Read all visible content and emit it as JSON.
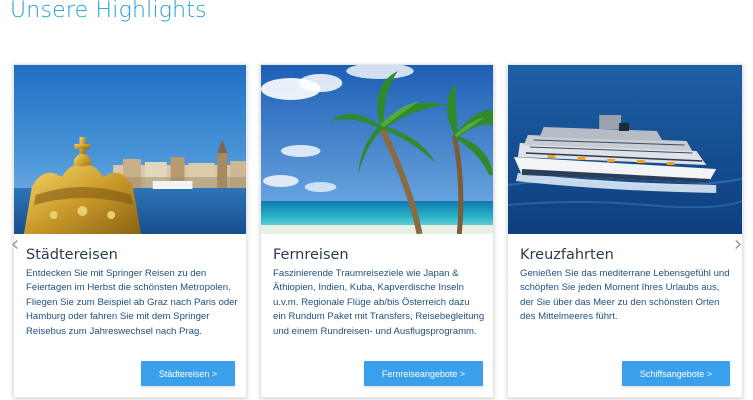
{
  "page": {
    "title": "Unsere Highlights"
  },
  "colors": {
    "accent": "#1f9dd9",
    "button": "#3aa0ec",
    "text": "#1f4f80"
  },
  "carousel": {
    "prev_icon": "chevron-left-icon",
    "next_icon": "chevron-right-icon",
    "prev_glyph": "‹",
    "next_glyph": "›",
    "cards": [
      {
        "image": "city-crown-photo",
        "title": "Städtereisen",
        "text": "Entdecken Sie mit Springer Reisen zu den Feiertagen im Herbst die schönsten Metropolen. Fliegen Sie zum Beispiel ab Graz nach Paris oder Hamburg oder fahren Sie mit dem Springer Reisebus zum Jahreswechsel nach Prag.",
        "button": "Städtereisen >"
      },
      {
        "image": "palm-beach-photo",
        "title": "Fernreisen",
        "text": "Faszinierende Traumreiseziele wie Japan & Äthiopien, Indien, Kuba, Kapverdische Inseln u.v.m. Regionale Flüge ab/bis Österreich dazu ein Rundum Paket mit Transfers, Reisebegleitung und einem Rundreisen- und Ausflugsprogramm.",
        "button": "Fernreiseangebote >"
      },
      {
        "image": "cruise-ship-photo",
        "title": "Kreuzfahrten",
        "text": "Genießen Sie das mediterrane Lebensgefühl und schöpfen Sie jeden Moment Ihres Urlaubs aus, der Sie über das Meer zu den schönsten Orten des Mittelmeeres führt.",
        "button": "Schiffsangebote >"
      }
    ]
  }
}
